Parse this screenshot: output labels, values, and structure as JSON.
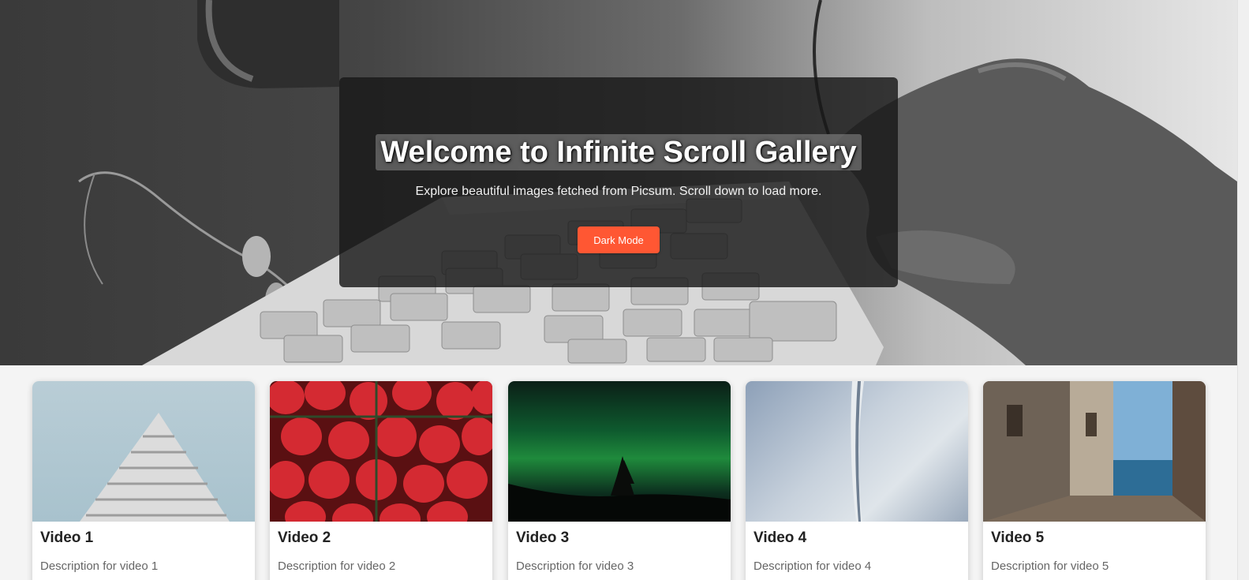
{
  "hero": {
    "title": "Welcome to Infinite Scroll Gallery",
    "subtitle": "Explore beautiful images fetched from Picsum. Scroll down to load more.",
    "dark_mode_label": "Dark Mode",
    "accent_color": "#ff5733"
  },
  "gallery": {
    "cards": [
      {
        "title": "Video 1",
        "description": "Description for video 1",
        "thumbnail": "building-pyramid-image"
      },
      {
        "title": "Video 2",
        "description": "Description for video 2",
        "thumbnail": "strawberries-image"
      },
      {
        "title": "Video 3",
        "description": "Description for video 3",
        "thumbnail": "aurora-image"
      },
      {
        "title": "Video 4",
        "description": "Description for video 4",
        "thumbnail": "abstract-sky-image"
      },
      {
        "title": "Video 5",
        "description": "Description for video 5",
        "thumbnail": "seaside-alley-image"
      }
    ]
  }
}
